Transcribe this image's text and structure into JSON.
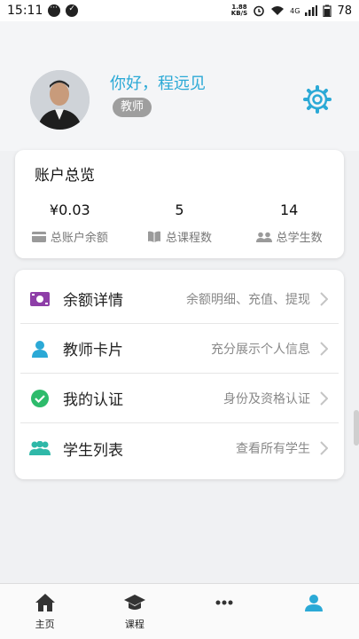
{
  "status_bar": {
    "time": "15:11",
    "net_speed_top": "1.88",
    "net_speed_unit": "KB/S",
    "network": "4G",
    "battery": "78"
  },
  "profile": {
    "greeting": "你好，程远见",
    "role": "教师"
  },
  "account": {
    "title": "账户总览",
    "stats": [
      {
        "value": "¥0.03",
        "label": "总账户余额",
        "icon": "wallet-icon"
      },
      {
        "value": "5",
        "label": "总课程数",
        "icon": "book-icon"
      },
      {
        "value": "14",
        "label": "总学生数",
        "icon": "people-icon"
      }
    ]
  },
  "menu": [
    {
      "label": "余额详情",
      "desc": "余额明细、充值、提现",
      "icon": "money-icon",
      "color": "#8e3ea8"
    },
    {
      "label": "教师卡片",
      "desc": "充分展示个人信息",
      "icon": "person-icon",
      "color": "#2ba9d6"
    },
    {
      "label": "我的认证",
      "desc": "身份及资格认证",
      "icon": "check-circle-icon",
      "color": "#2dbb6b"
    },
    {
      "label": "学生列表",
      "desc": "查看所有学生",
      "icon": "group-icon",
      "color": "#2fb8a8"
    }
  ],
  "bottom_nav": [
    {
      "label": "主页",
      "icon": "home-icon"
    },
    {
      "label": "课程",
      "icon": "graduation-cap-icon"
    },
    {
      "label": "",
      "icon": "more-icon"
    },
    {
      "label": "",
      "icon": "profile-icon"
    }
  ],
  "colors": {
    "accent": "#2ba9d6",
    "background": "#f0f1f3"
  }
}
